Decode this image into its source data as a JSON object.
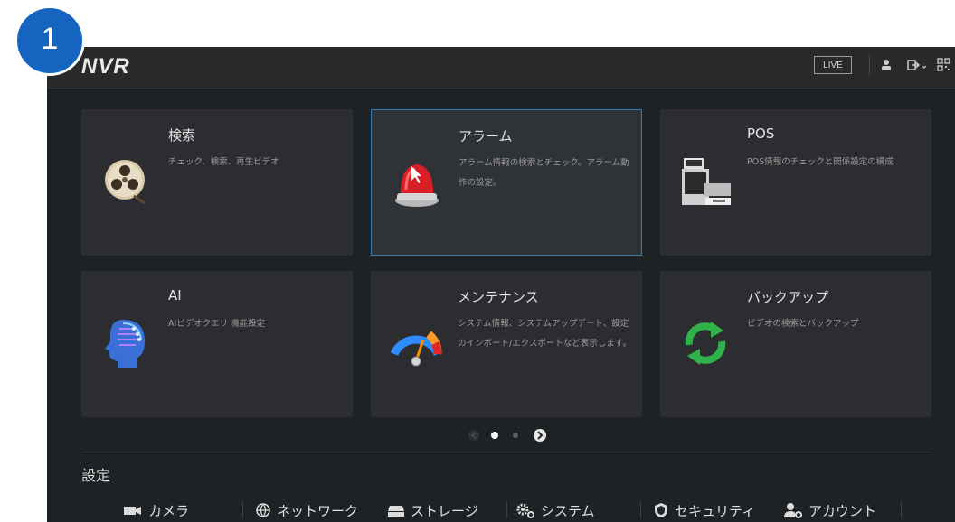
{
  "step_badge": "1",
  "header": {
    "logo": "NVR",
    "live_label": "LIVE",
    "icons": [
      "user-icon",
      "logout-icon",
      "qr-code-icon"
    ]
  },
  "cards": [
    {
      "title": "検索",
      "desc": "チェック、検索、再生ビデオ",
      "icon": "film-reel-icon"
    },
    {
      "title": "アラーム",
      "desc": "アラーム情報の検索とチェック。アラーム動作の設定。",
      "icon": "alarm-siren-icon"
    },
    {
      "title": "POS",
      "desc": "POS情報のチェックと関係設定の構成",
      "icon": "cash-register-icon"
    },
    {
      "title": "AI",
      "desc": "AIビデオクエリ 機能設定",
      "icon": "ai-head-icon"
    },
    {
      "title": "メンテナンス",
      "desc": "システム情報、システムアップデート、設定のインポート/エクスポートなど表示します。",
      "icon": "gauge-icon"
    },
    {
      "title": "バックアップ",
      "desc": "ビデオの検索とバックアップ",
      "icon": "sync-arrows-icon"
    }
  ],
  "pagination": {
    "pages": 3,
    "current": 1
  },
  "settings_section": {
    "title": "設定",
    "items": [
      {
        "label": "カメラ",
        "icon": "camera-icon"
      },
      {
        "label": "ネットワーク",
        "icon": "network-globe-icon"
      },
      {
        "label": "ストレージ",
        "icon": "hdd-icon"
      },
      {
        "label": "システム",
        "icon": "gears-icon"
      },
      {
        "label": "セキュリティ",
        "icon": "shield-icon"
      },
      {
        "label": "アカウント",
        "icon": "account-gear-icon"
      }
    ]
  },
  "colors": {
    "background": "#1f2224",
    "card": "#2b2d30",
    "selected_border": "#2e7fb0",
    "badge": "#1565c0"
  }
}
